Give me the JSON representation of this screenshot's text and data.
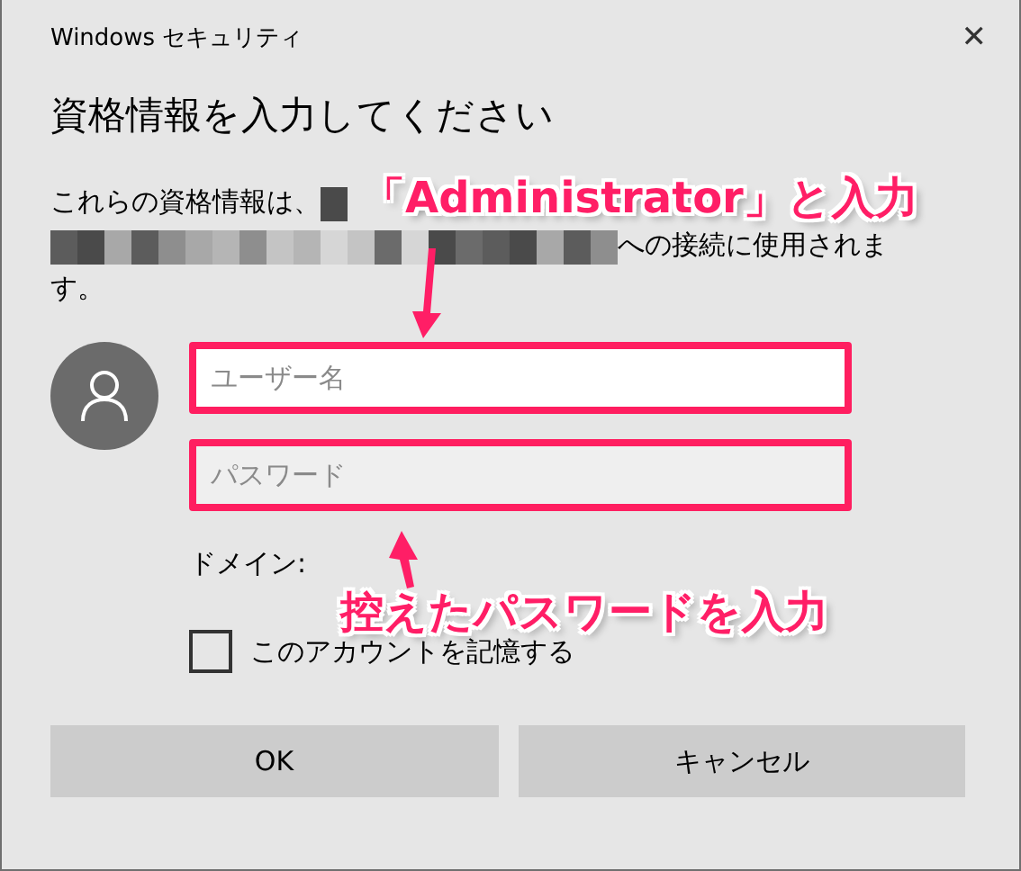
{
  "window": {
    "title": "Windows セキュリティ",
    "close": "✕"
  },
  "heading": "資格情報を入力してください",
  "message": {
    "before": "これらの資格情報は、",
    "after": [
      "への接続に使用されま",
      "す。"
    ]
  },
  "username": {
    "placeholder": "ユーザー名"
  },
  "password": {
    "placeholder": "パスワード"
  },
  "domain_label": "ドメイン:",
  "remember": {
    "label": "このアカウントを記憶する",
    "checked": false
  },
  "buttons": [
    "OK",
    "キャンセル"
  ],
  "annotations": [
    {
      "text": "「Administrator」と入力"
    },
    {
      "text": "控えたパスワードを入力"
    }
  ]
}
